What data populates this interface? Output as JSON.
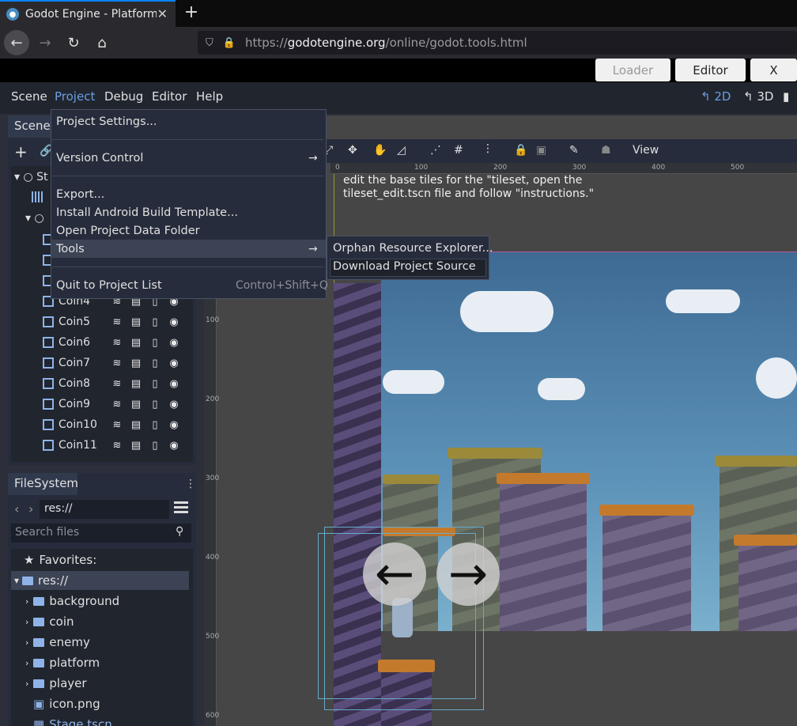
{
  "browser": {
    "tab_title": "Godot Engine - Platformer",
    "url_prefix": "https://",
    "url_host": "godotengine.org",
    "url_path": "/online/godot.tools.html"
  },
  "loader_bar": {
    "loader": "Loader",
    "editor": "Editor",
    "close": "X"
  },
  "menubar": {
    "items": [
      "Scene",
      "Project",
      "Debug",
      "Editor",
      "Help"
    ],
    "active": "Project",
    "view_2d": "2D",
    "view_3d": "3D"
  },
  "project_menu": {
    "project_settings": "Project Settings...",
    "version_control": "Version Control",
    "export": "Export...",
    "install_android": "Install Android Build Template...",
    "open_data_folder": "Open Project Data Folder",
    "tools": "Tools",
    "quit": "Quit to Project List",
    "quit_shortcut": "Control+Shift+Q"
  },
  "tools_submenu": {
    "orphan": "Orphan Resource Explorer...",
    "download": "Download Project Source"
  },
  "scene_dock": {
    "tab": "Scene",
    "root_partial": "St",
    "nodes": [
      "Coin4",
      "Coin5",
      "Coin6",
      "Coin7",
      "Coin8",
      "Coin9",
      "Coin10",
      "Coin11"
    ]
  },
  "viewport": {
    "view_menu": "View",
    "help_line1": "edit the base tiles for the \"tileset, open the",
    "help_line2": "tileset_edit.tscn file and follow \"instructions.\"",
    "ruler_top": [
      "0",
      "100",
      "200",
      "300",
      "400",
      "500"
    ],
    "ruler_left": [
      "100",
      "200",
      "300",
      "400",
      "500",
      "600"
    ]
  },
  "filesystem": {
    "tab": "FileSystem",
    "path": "res://",
    "search_placeholder": "Search files",
    "favorites": "Favorites:",
    "root": "res://",
    "folders": [
      "background",
      "coin",
      "enemy",
      "platform",
      "player"
    ],
    "files": [
      "icon.png",
      "Stage.tscn"
    ]
  },
  "colors": {
    "godot_bg": "#20252e",
    "menu_active": "#6d9fe0",
    "accent_blue": "#8fb3e8"
  }
}
